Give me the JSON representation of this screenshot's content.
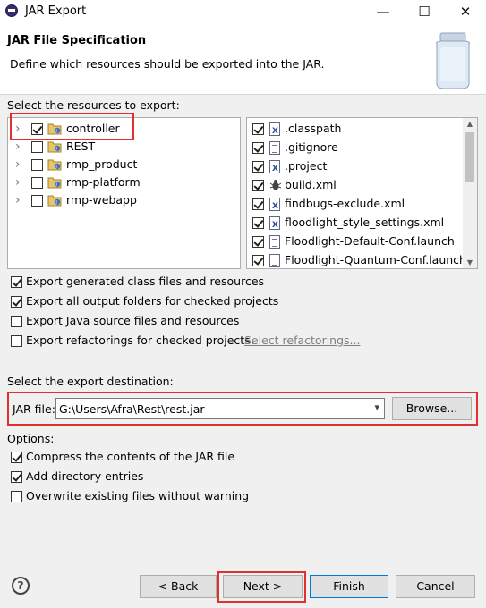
{
  "window": {
    "title": "JAR Export",
    "minimize_label": "—",
    "maximize_label": "☐",
    "close_label": "✕"
  },
  "header": {
    "title": "JAR File Specification",
    "description": "Define which resources should be exported into the JAR."
  },
  "resources": {
    "label": "Select the resources to export:",
    "projects": [
      {
        "name": "controller",
        "checked": true,
        "expandable": true
      },
      {
        "name": "REST",
        "checked": false,
        "expandable": true
      },
      {
        "name": "rmp_product",
        "checked": false,
        "expandable": true
      },
      {
        "name": "rmp-platform",
        "checked": false,
        "expandable": true
      },
      {
        "name": "rmp-webapp",
        "checked": false,
        "expandable": true
      }
    ],
    "files": [
      {
        "name": ".classpath",
        "checked": true,
        "icon": "xml-file-icon"
      },
      {
        "name": ".gitignore",
        "checked": true,
        "icon": "text-file-icon"
      },
      {
        "name": ".project",
        "checked": true,
        "icon": "xml-file-icon"
      },
      {
        "name": "build.xml",
        "checked": true,
        "icon": "ant-file-icon"
      },
      {
        "name": "findbugs-exclude.xml",
        "checked": true,
        "icon": "xml-file-icon"
      },
      {
        "name": "floodlight_style_settings.xml",
        "checked": true,
        "icon": "xml-file-icon"
      },
      {
        "name": "Floodlight-Default-Conf.launch",
        "checked": true,
        "icon": "text-file-icon"
      },
      {
        "name": "Floodlight-Quantum-Conf.launch",
        "checked": true,
        "icon": "text-file-icon"
      }
    ]
  },
  "options_top": [
    {
      "label": "Export generated class files and resources",
      "checked": true
    },
    {
      "label": "Export all output folders for checked projects",
      "checked": true
    },
    {
      "label": "Export Java source files and resources",
      "checked": false
    },
    {
      "label": "Export refactorings for checked projects.",
      "checked": false
    }
  ],
  "select_refactorings_link": "Select refactorings...",
  "destination": {
    "label": "Select the export destination:",
    "jar_file_label": "JAR file:",
    "jar_file_value": "G:\\Users\\Afra\\Rest\\rest.jar",
    "browse_label": "Browse..."
  },
  "options": {
    "label": "Options:",
    "items": [
      {
        "label": "Compress the contents of the JAR file",
        "checked": true
      },
      {
        "label": "Add directory entries",
        "checked": true
      },
      {
        "label": "Overwrite existing files without warning",
        "checked": false
      }
    ]
  },
  "footer": {
    "help_label": "?",
    "back_label": "< Back",
    "next_label": "Next >",
    "finish_label": "Finish",
    "cancel_label": "Cancel"
  },
  "colors": {
    "highlight": "#e03030",
    "default_button_border": "#0078d7",
    "link": "#7f7f7f"
  }
}
